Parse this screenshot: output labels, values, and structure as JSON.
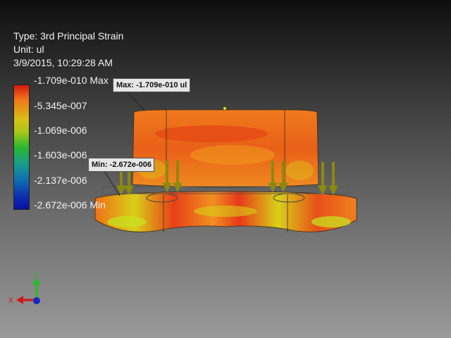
{
  "legend": {
    "type_label": "Type: 3rd Principal Strain",
    "unit_label": "Unit: ul",
    "timestamp": "3/9/2015, 10:29:28 AM",
    "ticks": [
      "-1.709e-010 Max",
      "-5.345e-007",
      "-1.069e-006",
      "-1.603e-006",
      "-2.137e-006",
      "-2.672e-006 Min"
    ]
  },
  "callouts": {
    "max": "Max: -1.709e-010 ul",
    "min": "Min: -2.672e-006 ul"
  },
  "triad": {
    "x_label": "X",
    "y_label": "Y"
  },
  "colors": {
    "max": "#d61a10",
    "high": "#f0781a",
    "mid": "#d8c016",
    "green": "#2cb82c",
    "low": "#1070b0",
    "min": "#0612a0",
    "load_arrow": "#8a8a10"
  }
}
